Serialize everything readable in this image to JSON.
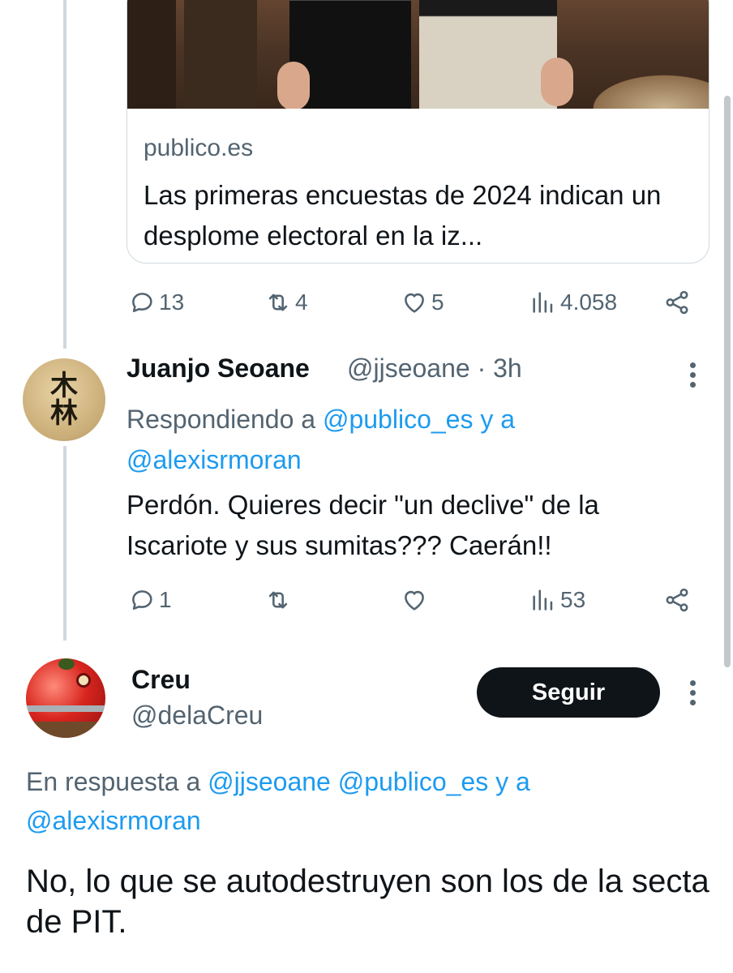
{
  "link_card": {
    "domain": "publico.es",
    "title": "Las primeras encuestas de 2024 indican un desplome electoral en la iz..."
  },
  "tweet0_actions": {
    "replies": "13",
    "retweets": "4",
    "likes": "5",
    "views": "4.058"
  },
  "tweet1": {
    "name": "Juanjo Seoane",
    "handle_time": "@jjseoane · 3h",
    "reply_prefix": "Respondiendo a ",
    "mention1": "@publico_es",
    "reply_join": " y a ",
    "mention2": "@alexisrmoran",
    "text": "Perdón. Quieres decir \"un declive\" de la Iscariote y sus sumitas??? Caerán!!",
    "avatar_glyph_top": "木",
    "avatar_glyph_bottom": "林",
    "actions": {
      "replies": "1",
      "retweets": "",
      "likes": "",
      "views": "53"
    }
  },
  "tweet2": {
    "name": "Creu",
    "handle": "@delaCreu",
    "follow_label": "Seguir",
    "reply_prefix": "En respuesta a ",
    "mention1": "@jjseoane",
    "mention2": "@publico_es",
    "reply_join": " y a",
    "mention3": "@alexisrmoran",
    "text": "No, lo que se autodestruyen son los de la secta de PIT."
  },
  "icons": {
    "reply": "reply-bubble-icon",
    "retweet": "retweet-icon",
    "like": "heart-icon",
    "views": "views-bar-icon",
    "share": "share-icon",
    "more": "more-vertical-icon"
  },
  "colors": {
    "accent": "#1d9bf0",
    "secondary_text": "#536471",
    "primary_text": "#0f1419",
    "border": "#cfd9de",
    "follow_button_bg": "#0f1419"
  }
}
